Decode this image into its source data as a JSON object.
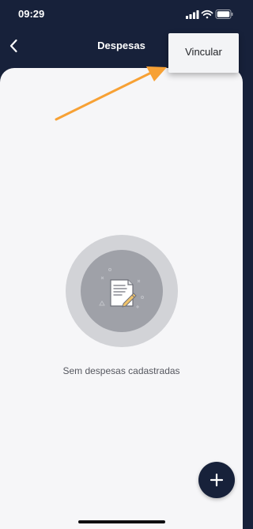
{
  "status_bar": {
    "time": "09:29",
    "icons": [
      "signal-icon",
      "wifi-icon",
      "battery-icon"
    ]
  },
  "header": {
    "title": "Despesas",
    "back_icon": "chevron-left-icon"
  },
  "menu": {
    "items": [
      {
        "label": "Vincular"
      }
    ]
  },
  "empty_state": {
    "icon": "document-edit-icon",
    "message": "Sem despesas cadastradas"
  },
  "fab": {
    "icon": "plus-icon"
  },
  "colors": {
    "header_bg": "#17213a",
    "content_bg": "#f6f6f8",
    "annotation_arrow": "#f7a135",
    "menu_bg": "#f3f4f6"
  }
}
